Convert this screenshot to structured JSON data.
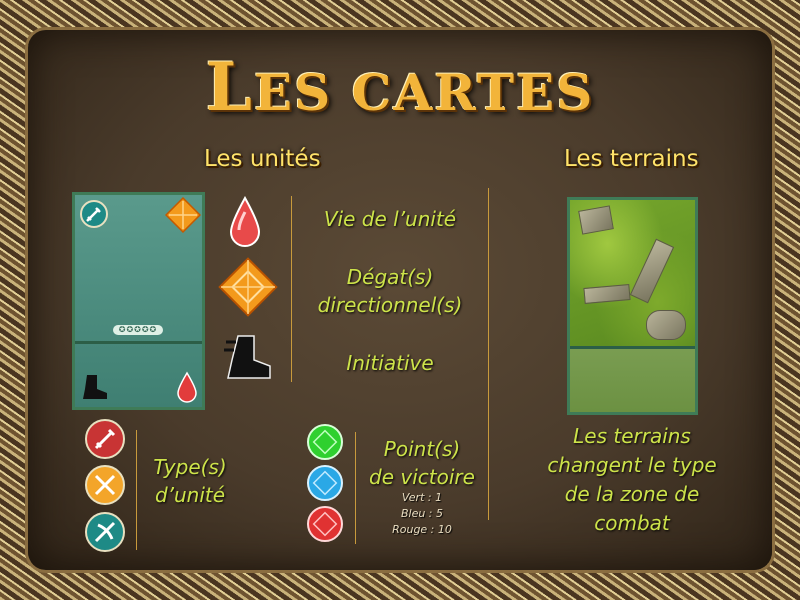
{
  "title": {
    "first_letter": "L",
    "rest": "ES CARTES"
  },
  "units": {
    "heading": "Les unités",
    "life_label": "Vie de l’unité",
    "damage_label_1": "Dégat(s)",
    "damage_label_2": "directionnel(s)",
    "initiative_label": "Initiative",
    "unit_type_1": "Type(s)",
    "unit_type_2": "d’unité",
    "victory_1": "Point(s)",
    "victory_2": "de victoire",
    "green_value": "Vert : 1",
    "blue_value": "Bleu : 5",
    "red_value": "Rouge : 10",
    "card_stars": "✪✪✪✪✪"
  },
  "terrains": {
    "heading": "Les terrains",
    "desc_1": "Les terrains",
    "desc_2": "changent le type",
    "desc_3": "de la zone de",
    "desc_4": "combat"
  },
  "colors": {
    "title": "#f2b43a",
    "heading": "#ffe36a",
    "label": "#cde34a",
    "life": "#e23c3c",
    "damage": "#f39a1c",
    "gem_green": "#2fd02f",
    "gem_blue": "#2aa8e6",
    "gem_red": "#e03232"
  },
  "icons": [
    "sword-icon",
    "diamond-arrows-icon",
    "blood-drop-icon",
    "boot-icon",
    "crossed-weapons-icon",
    "bow-icon",
    "gem-icon"
  ]
}
